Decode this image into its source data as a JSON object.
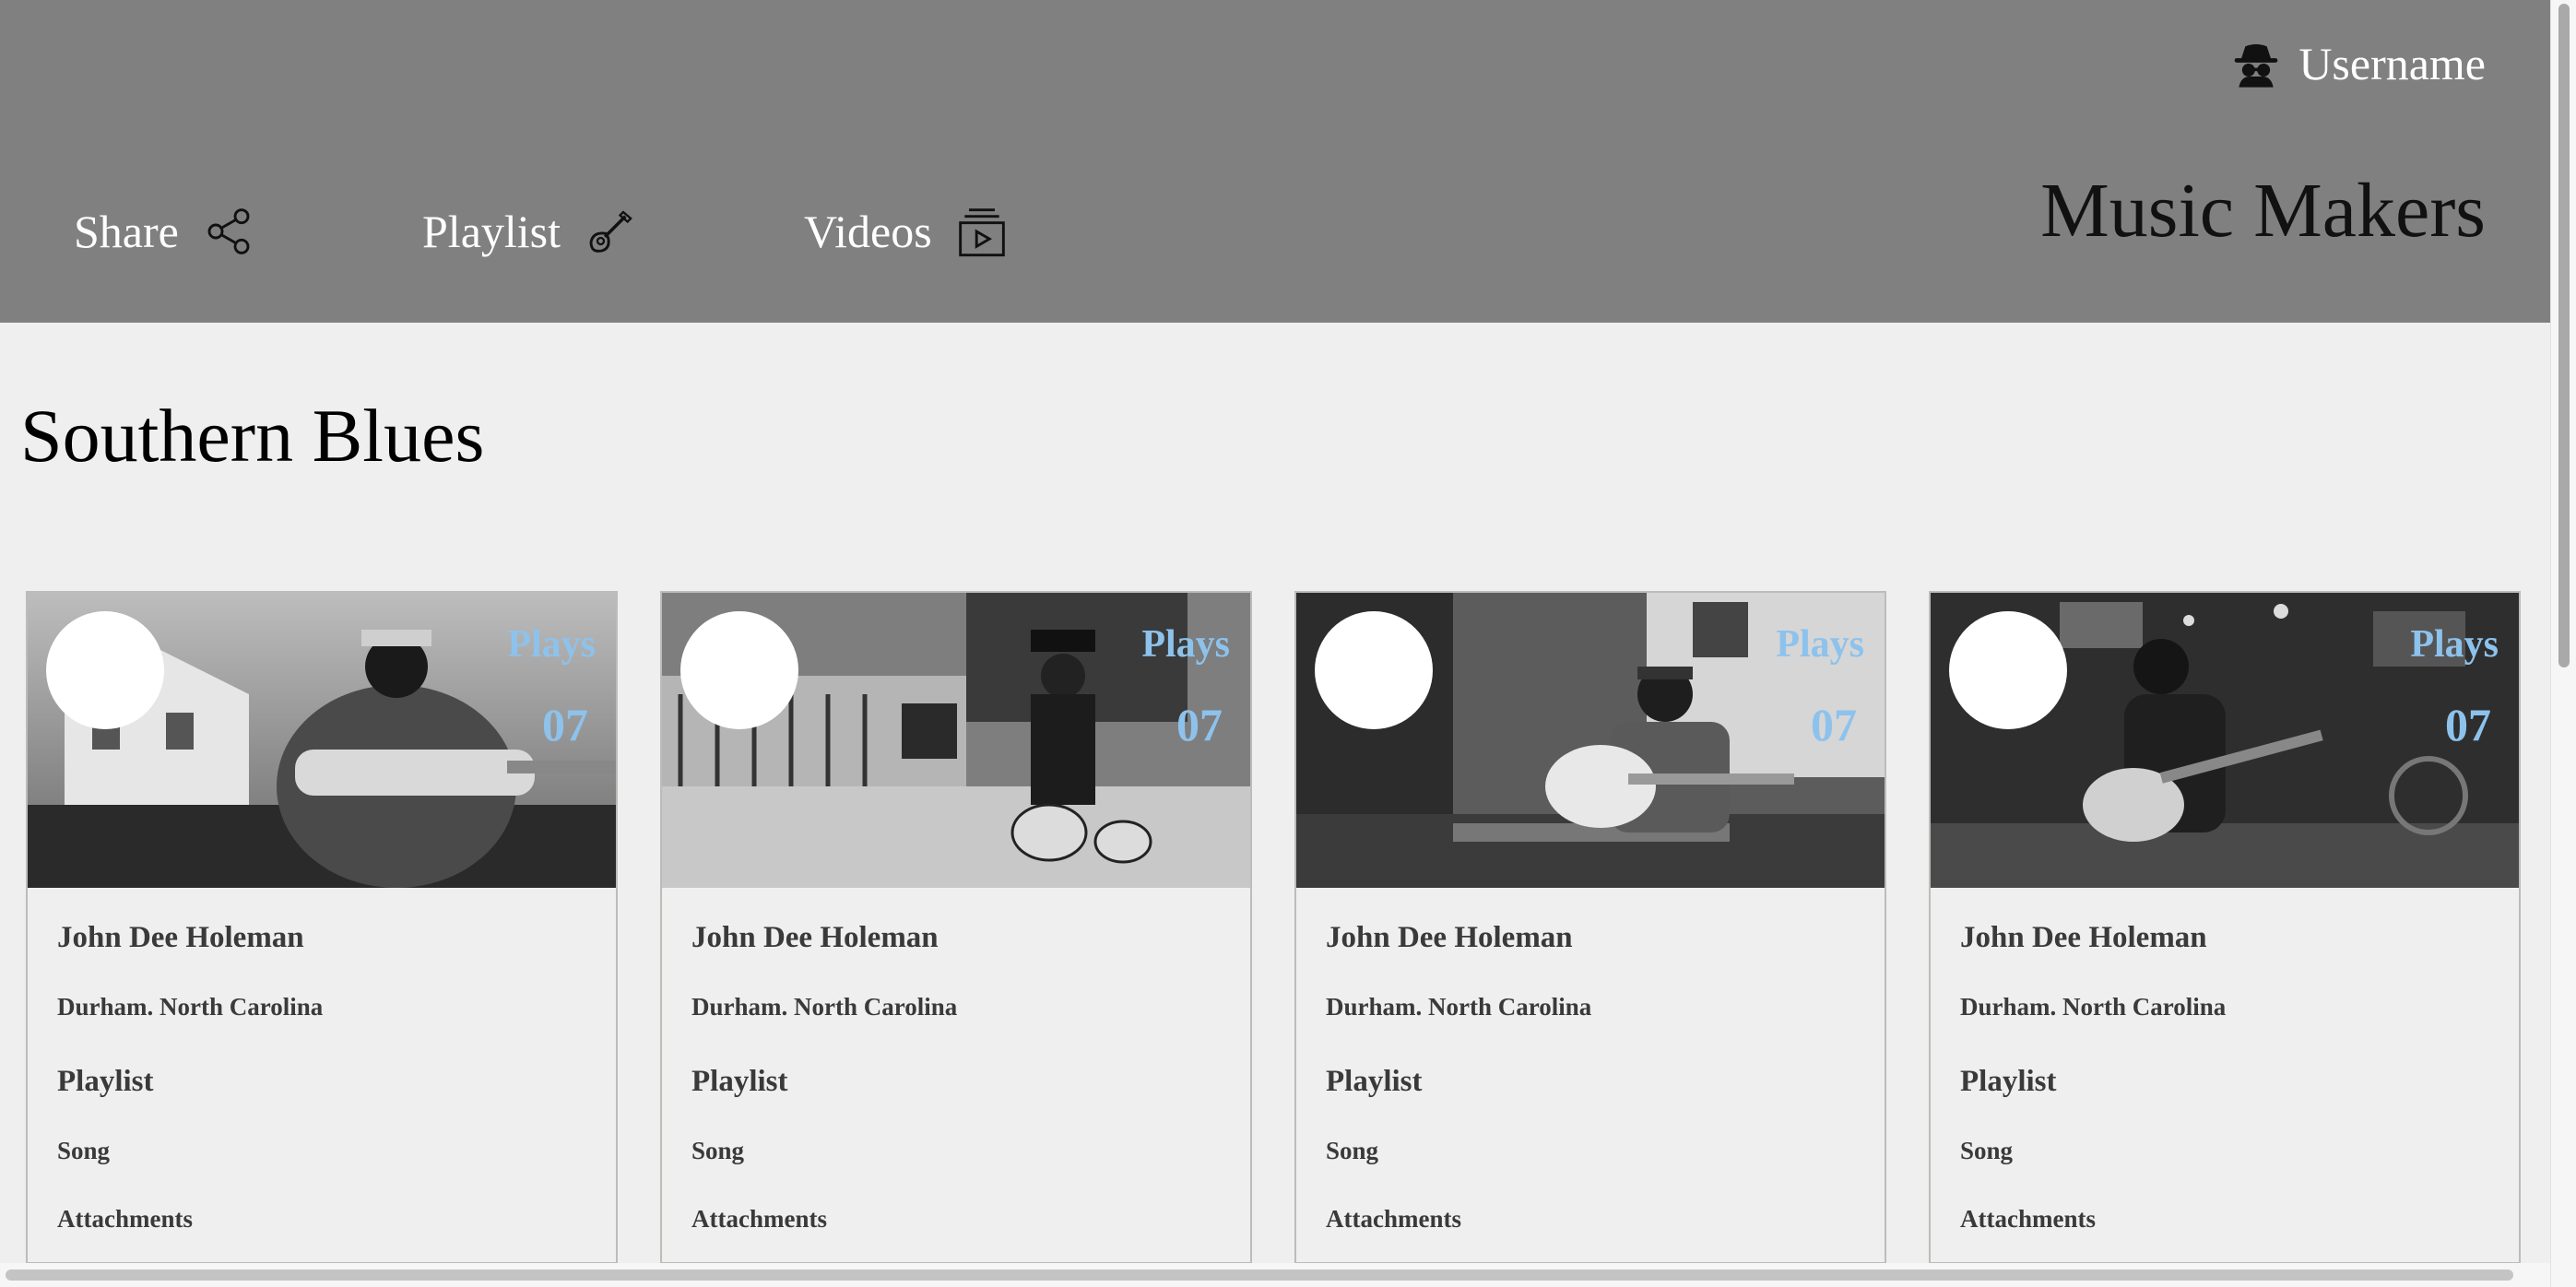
{
  "header": {
    "username": "Username",
    "app_title": "Music Makers",
    "nav": [
      {
        "label": "Share",
        "icon": "share-icon"
      },
      {
        "label": "Playlist",
        "icon": "guitar-icon"
      },
      {
        "label": "Videos",
        "icon": "video-library-icon"
      }
    ],
    "user_icon": "incognito-user-icon"
  },
  "page": {
    "title": "Southern Blues"
  },
  "cards": [
    {
      "name": "John Dee Holeman",
      "location": "Durham. North Carolina",
      "playlist": "Playlist",
      "song": "Song",
      "attachments": "Attachments",
      "plays_label": "Plays",
      "plays": "07"
    },
    {
      "name": "John Dee Holeman",
      "location": "Durham. North Carolina",
      "playlist": "Playlist",
      "song": "Song",
      "attachments": "Attachments",
      "plays_label": "Plays",
      "plays": "07"
    },
    {
      "name": "John Dee Holeman",
      "location": "Durham. North Carolina",
      "playlist": "Playlist",
      "song": "Song",
      "attachments": "Attachments",
      "plays_label": "Plays",
      "plays": "07"
    },
    {
      "name": "John Dee Holeman",
      "location": "Durham. North Carolina",
      "playlist": "Playlist",
      "song": "Song",
      "attachments": "Attachments",
      "plays_label": "Plays",
      "plays": "07"
    }
  ],
  "colors": {
    "header_bg": "#808080",
    "page_bg": "#efefef",
    "plays_accent": "#8dc2ec"
  }
}
